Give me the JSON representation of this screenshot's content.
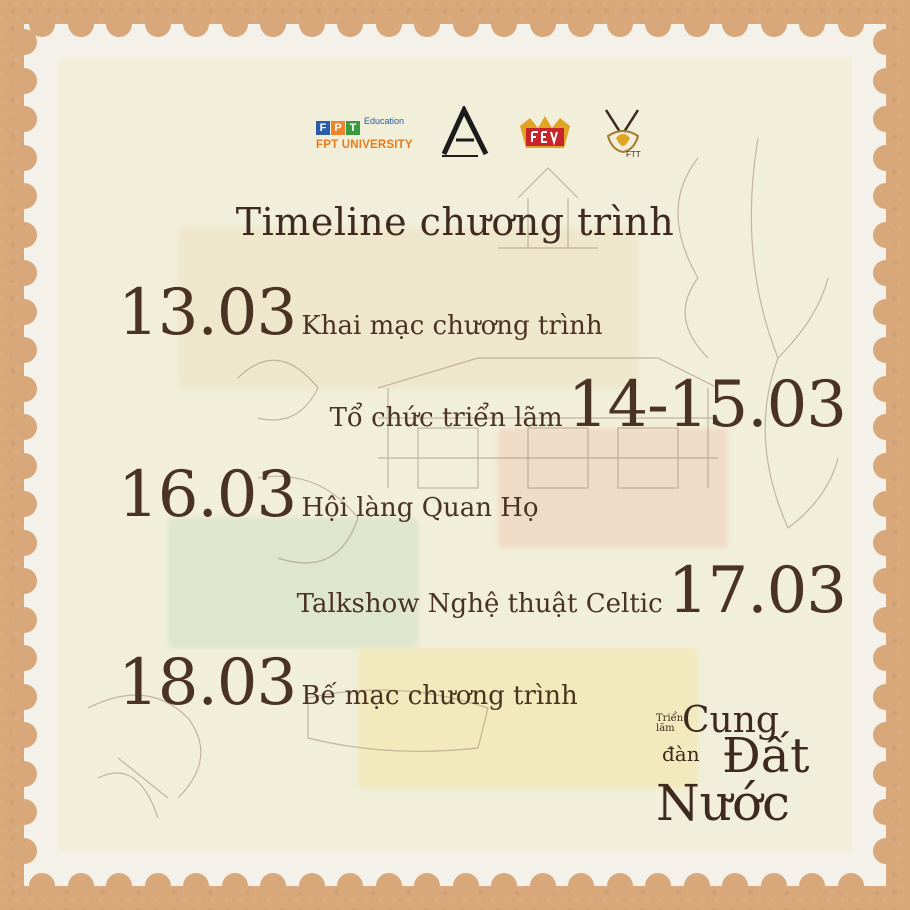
{
  "logos": {
    "fpt_letters": [
      "F",
      "P",
      "T"
    ],
    "fpt_letter_colors": [
      "#2a5ca8",
      "#f0842c",
      "#3a9a3f"
    ],
    "fpt_education": "Education",
    "fpt_university": "FPT UNIVERSITY",
    "fpt_around_icon": "fpt-around-logo-icon",
    "fev_icon": "fev-logo-icon",
    "ftt_icon": "ftt-logo-icon",
    "ftt_label": "FTT"
  },
  "title": "Timeline chương trình",
  "timeline": [
    {
      "date": "13.03",
      "event": "Khai mạc chương trình"
    },
    {
      "date": "14-15.03",
      "event": "Tổ chức triển lãm"
    },
    {
      "date": "16.03",
      "event": "Hội làng Quan Họ"
    },
    {
      "date": "17.03",
      "event": "Talkshow Nghệ thuật Celtic"
    },
    {
      "date": "18.03",
      "event": "Bế mạc chương trình"
    }
  ],
  "brand": {
    "line1_small": "Triển lãm",
    "line1_big": "Cung",
    "line2_small": "đàn",
    "line2_big": "Đất",
    "line3_big": "Nước"
  },
  "colors": {
    "kraft": "#d8a77a",
    "stamp_paper": "#f1eed9",
    "ink": "#4a3322"
  }
}
